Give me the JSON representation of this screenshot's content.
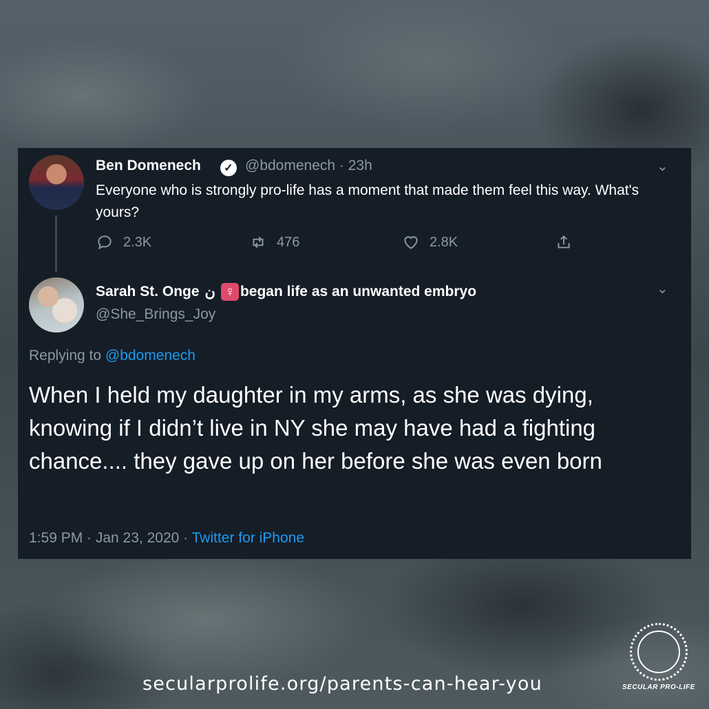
{
  "tweet1": {
    "name": "Ben Domenech",
    "handle_time": "@bdomenech · 23h",
    "text": "Everyone who is strongly pro-life has a moment that made them feel this way. What's yours?",
    "replies": "2.3K",
    "retweets": "476",
    "likes": "2.8K"
  },
  "tweet2": {
    "name": "Sarah St. Onge",
    "name_symbol": "ن",
    "bio_tail": "began life as an unwanted embryo",
    "handle": "@She_Brings_Joy",
    "replying_prefix": "Replying to",
    "replying_to": "@bdomenech",
    "text": "When I held my daughter in my arms, as she was dying, knowing if I didn’t live in NY she may have had a fighting chance.... they gave up on her before she was even born",
    "timestamp": "1:59 PM · Jan 23, 2020 ·",
    "source": "Twitter for iPhone"
  },
  "footer": {
    "url": "secularprolife.org/parents-can-hear-you",
    "logo_text": "SECULAR PRO-LIFE"
  },
  "colors": {
    "card_bg": "#151d27",
    "link": "#1d9bf0",
    "muted": "#8c99a5"
  }
}
